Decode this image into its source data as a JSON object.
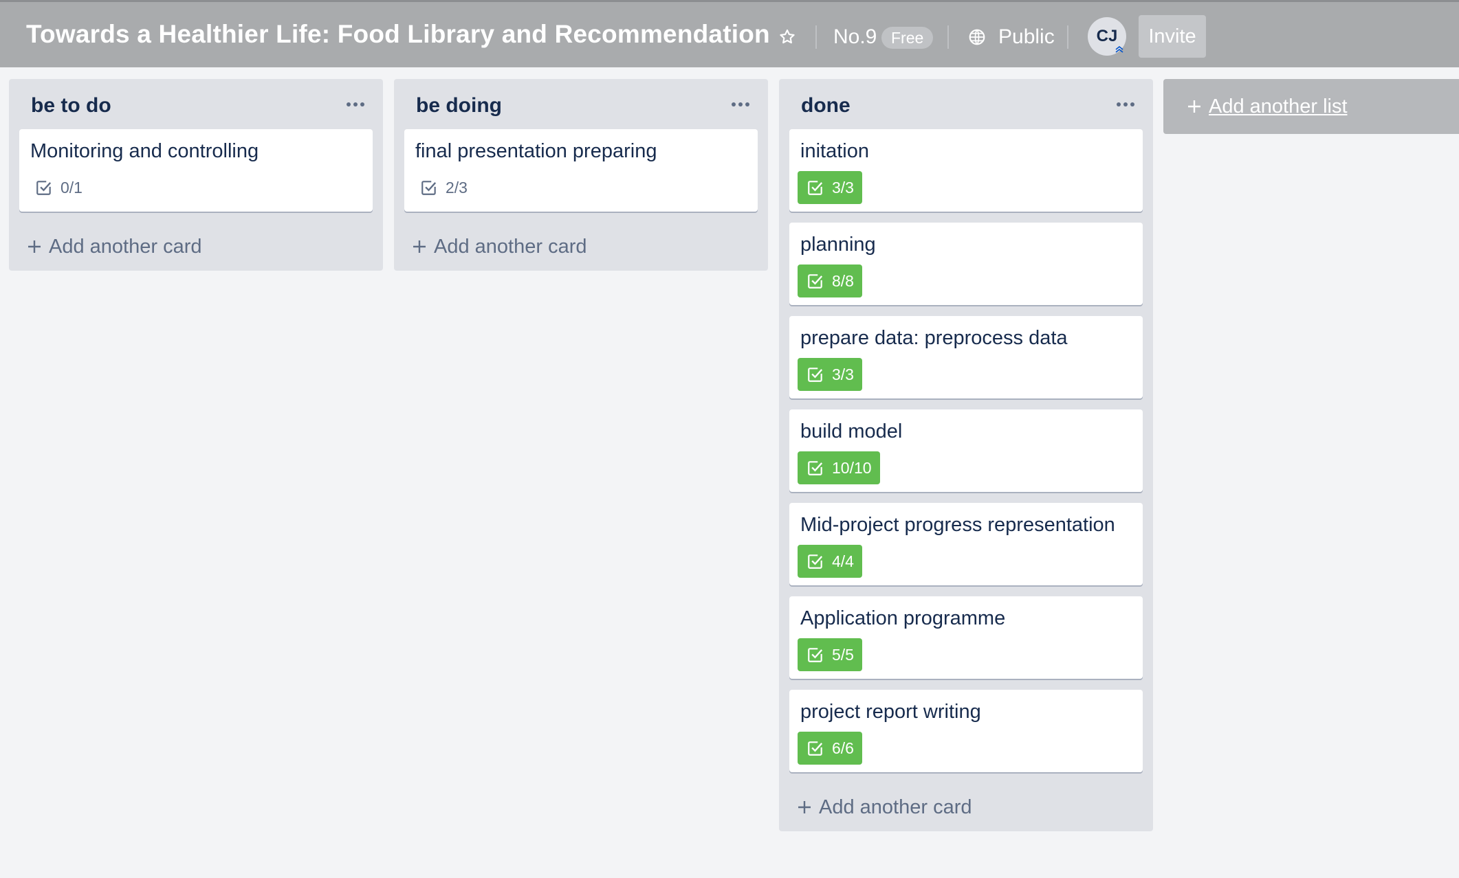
{
  "board": {
    "title": "Towards a Healthier Life: Food Library and Recommendation",
    "team_name": "No.9",
    "plan_badge": "Free",
    "visibility": "Public",
    "member_initials": "CJ",
    "invite_label": "Invite",
    "add_list_label": "Add another list"
  },
  "colors": {
    "header_bg": "#a9abad",
    "list_bg": "#dfe1e6",
    "board_bg": "#f3f4f6",
    "complete_badge": "#61bd4f"
  },
  "lists": [
    {
      "title": "be to do",
      "add_card_label": "Add another card",
      "cards": [
        {
          "title": "Monitoring and controlling",
          "checklist": "0/1",
          "complete": false
        }
      ]
    },
    {
      "title": "be doing",
      "add_card_label": "Add another card",
      "cards": [
        {
          "title": "final presentation preparing",
          "checklist": "2/3",
          "complete": false
        }
      ]
    },
    {
      "title": "done",
      "add_card_label": "Add another card",
      "cards": [
        {
          "title": "initation",
          "checklist": "3/3",
          "complete": true
        },
        {
          "title": "planning",
          "checklist": "8/8",
          "complete": true
        },
        {
          "title": "prepare data: preprocess data",
          "checklist": "3/3",
          "complete": true
        },
        {
          "title": "build model",
          "checklist": "10/10",
          "complete": true
        },
        {
          "title": "Mid-project progress representation",
          "checklist": "4/4",
          "complete": true
        },
        {
          "title": "Application programme",
          "checklist": "5/5",
          "complete": true
        },
        {
          "title": "project report writing",
          "checklist": "6/6",
          "complete": true
        }
      ]
    }
  ]
}
